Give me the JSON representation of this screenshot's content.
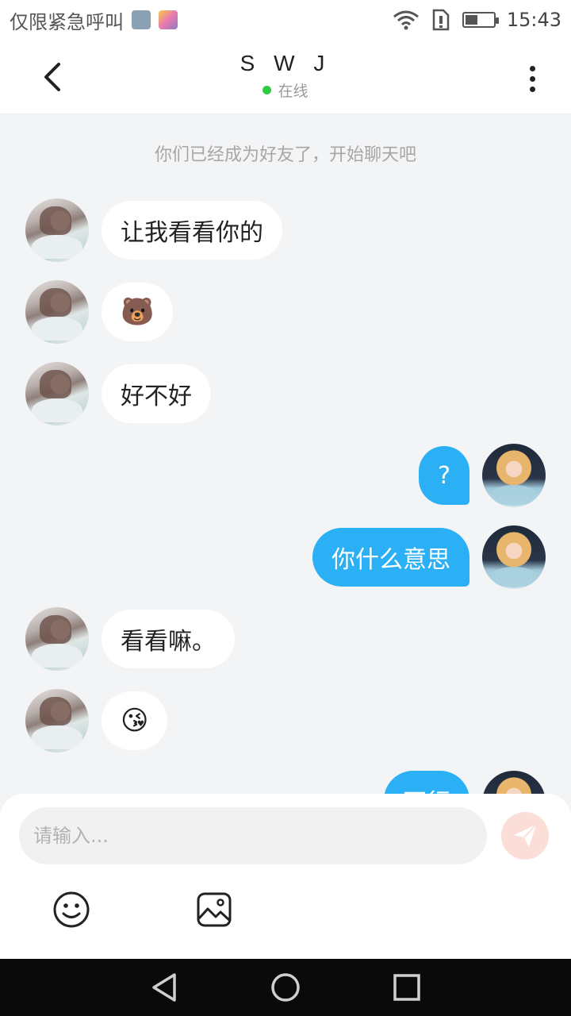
{
  "status_bar": {
    "carrier_text": "仅限紧急呼叫",
    "time": "15:43",
    "battery_level": 0.45,
    "icons": [
      "image-thumb-icon",
      "app-thumb-icon",
      "wifi-icon",
      "sim-alert-icon",
      "battery-icon"
    ]
  },
  "header": {
    "title": "S W J",
    "status": "在线",
    "status_color": "#2ecc40"
  },
  "chat": {
    "system_message": "你们已经成为好友了，开始聊天吧",
    "messages": [
      {
        "side": "other",
        "text": "让我看看你的"
      },
      {
        "side": "other",
        "text": "🐻"
      },
      {
        "side": "other",
        "text": "好不好"
      },
      {
        "side": "self",
        "text": "?"
      },
      {
        "side": "self",
        "text": "你什么意思"
      },
      {
        "side": "other",
        "text": "看看嘛。"
      },
      {
        "side": "other",
        "text": "😘"
      },
      {
        "side": "self",
        "text": "不行"
      }
    ]
  },
  "input": {
    "placeholder": "请输入...",
    "value": ""
  },
  "colors": {
    "self_bubble": "#2bb0f5",
    "other_bubble": "#ffffff",
    "background": "#f3f4f6",
    "send_button": "#fcded9"
  }
}
